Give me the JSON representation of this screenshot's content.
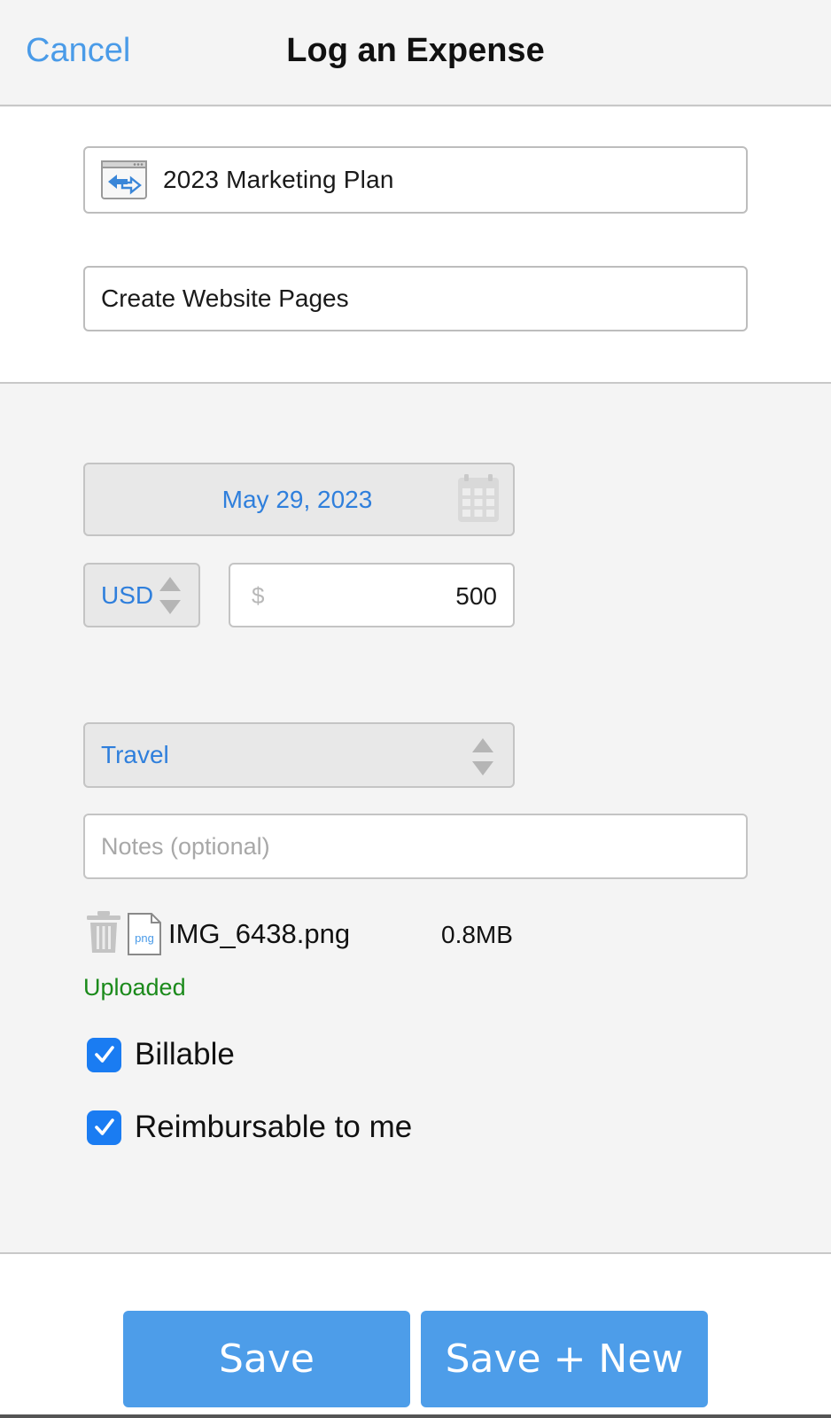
{
  "header": {
    "cancel_label": "Cancel",
    "title": "Log an Expense"
  },
  "project": {
    "label": "2023 Marketing Plan",
    "icon": "project-icon"
  },
  "task": {
    "label": "Create Website Pages"
  },
  "date": {
    "value": "May 29, 2023",
    "icon": "calendar-icon"
  },
  "currency": {
    "value": "USD",
    "icon": "updown-arrows-icon"
  },
  "amount": {
    "symbol": "$",
    "value": "500"
  },
  "category": {
    "value": "Travel",
    "icon": "updown-arrows-icon"
  },
  "notes": {
    "placeholder": "Notes (optional)",
    "value": ""
  },
  "attachment": {
    "file_name": "IMG_6438.png",
    "file_size": "0.8MB",
    "file_type_label": "png",
    "status": "Uploaded",
    "status_color": "#1b8a1b"
  },
  "options": {
    "billable_label": "Billable",
    "billable_checked": true,
    "reimbursable_label": "Reimbursable to me",
    "reimbursable_checked": true
  },
  "actions": {
    "save_label": "Save",
    "save_new_label": "Save + New"
  },
  "colors": {
    "accent": "#4a9be8",
    "link_blue": "#2f7fdc",
    "button_blue": "#4d9de9",
    "checkbox_blue": "#1a7cf2"
  }
}
